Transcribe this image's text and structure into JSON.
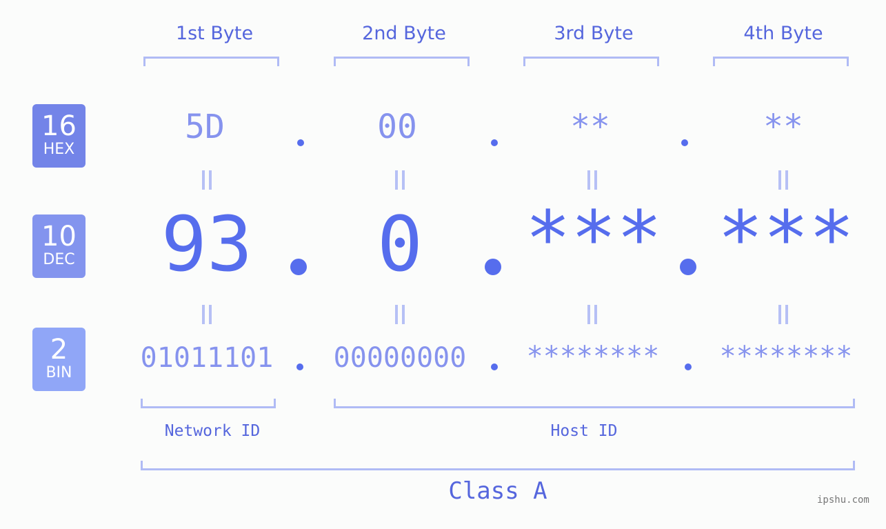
{
  "headers": [
    "1st Byte",
    "2nd Byte",
    "3rd Byte",
    "4th Byte"
  ],
  "badges": [
    {
      "num": "16",
      "label": "HEX",
      "color": "#7384e8"
    },
    {
      "num": "10",
      "label": "DEC",
      "color": "#8394ee"
    },
    {
      "num": "2",
      "label": "BIN",
      "color": "#90a6f7"
    }
  ],
  "hex": [
    "5D",
    "00",
    "**",
    "**"
  ],
  "dec": [
    "93",
    "0",
    "***",
    "***"
  ],
  "bin": [
    "01011101",
    "00000000",
    "********",
    "********"
  ],
  "separator": ".",
  "network_label": "Network ID",
  "host_label": "Host ID",
  "class_label": "Class A",
  "watermark": "ipshu.com",
  "colors": {
    "accent": "#566ded",
    "light": "#8693ee",
    "bracket": "#b0bbf5",
    "background": "#fbfcfb"
  }
}
